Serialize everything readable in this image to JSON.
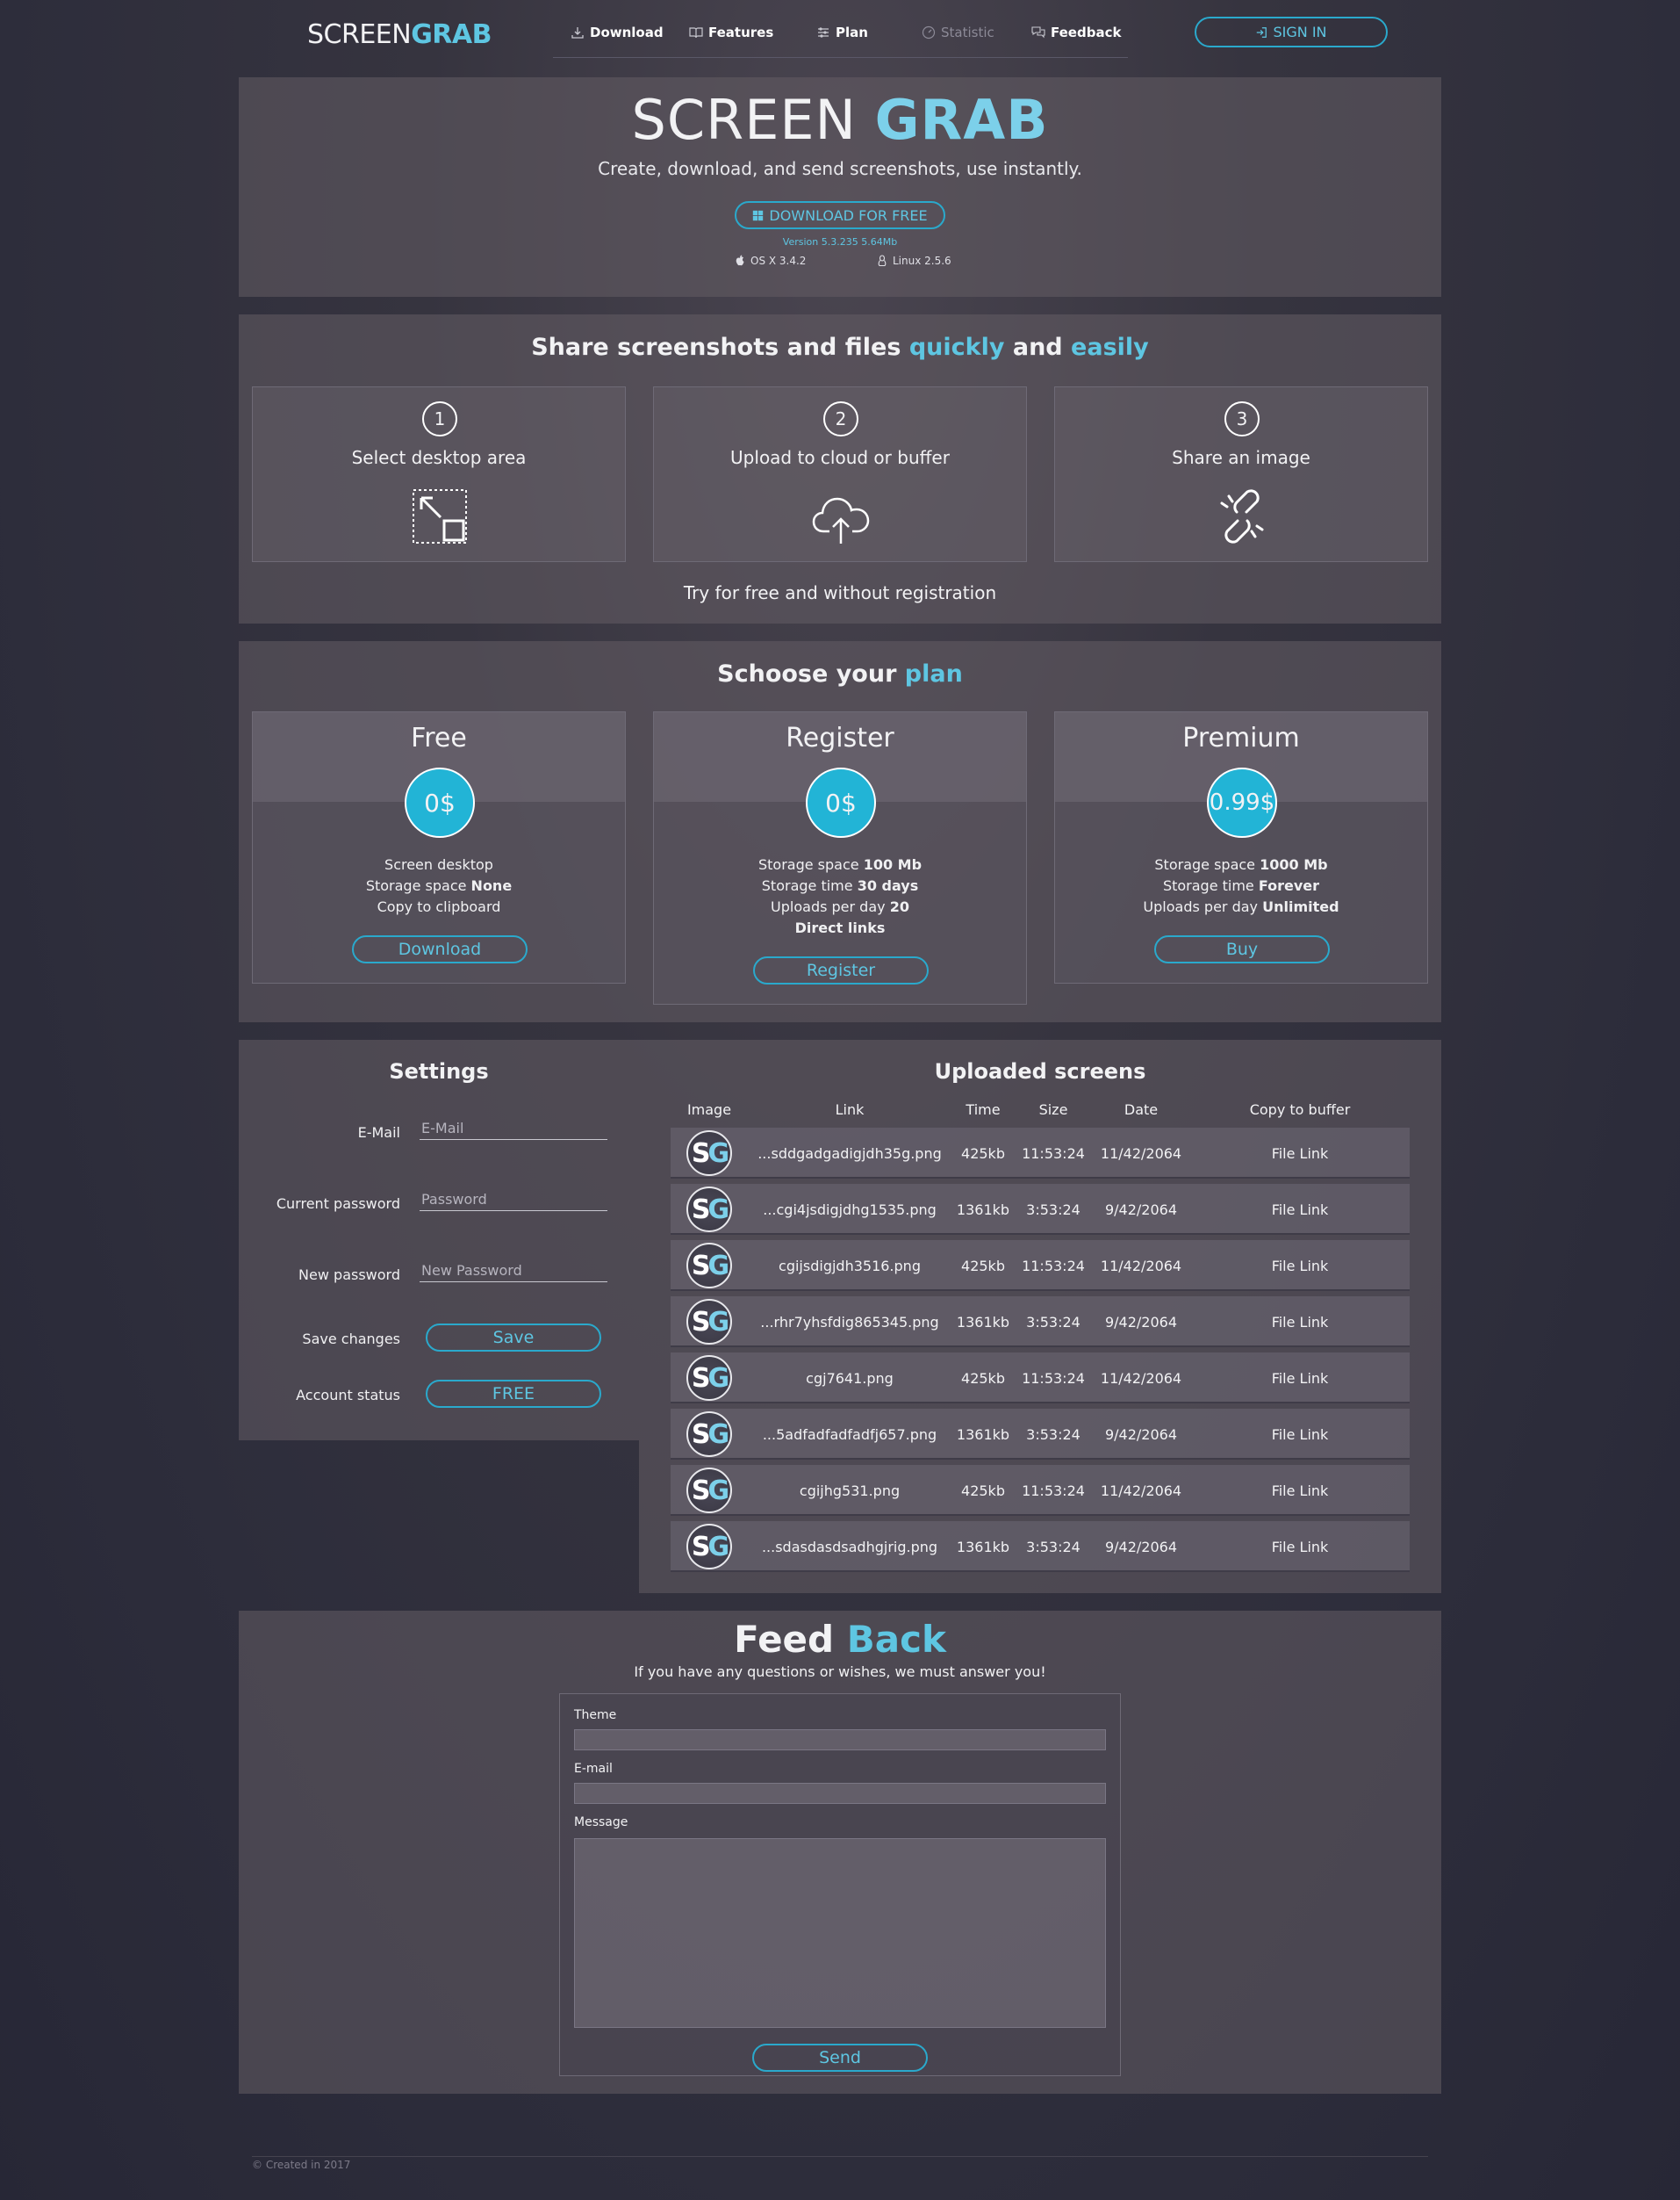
{
  "colors": {
    "accent": "#5ec6e2",
    "button_border": "#2aa9cc",
    "price_circle": "#22b4d6"
  },
  "header": {
    "logo_thin": "SCREEN",
    "logo_bold": "GRAB",
    "nav": [
      {
        "label": "Download",
        "icon": "download-icon"
      },
      {
        "label": "Features",
        "icon": "book-icon"
      },
      {
        "label": "Plan",
        "icon": "sliders-icon"
      },
      {
        "label": "Statistic",
        "icon": "gauge-icon"
      },
      {
        "label": "Feedback",
        "icon": "chat-icon"
      }
    ],
    "signin_label": "SIGN IN"
  },
  "hero": {
    "title_thin": "SCREEN",
    "title_bold": "GRAB",
    "subtitle": "Create, download, and send screenshots, use instantly.",
    "download_label": "DOWNLOAD FOR FREE",
    "version": "Version 5.3.235 5.64Mb",
    "os_mac": "OS X 3.4.2",
    "os_linux": "Linux 2.5.6"
  },
  "share": {
    "title_pre": "Share screenshots and files ",
    "title_quickly": "quickly",
    "title_and": " and ",
    "title_easily": "easily",
    "steps": [
      {
        "num": "1",
        "label": "Select desktop area",
        "icon": "select-area-icon"
      },
      {
        "num": "2",
        "label": "Upload to cloud or buffer",
        "icon": "cloud-upload-icon"
      },
      {
        "num": "3",
        "label": "Share an image",
        "icon": "link-icon"
      }
    ],
    "try_free": "Try for free and without registration"
  },
  "plans": {
    "title_pre": "Schoose your ",
    "title_accent": "plan",
    "items": [
      {
        "name": "Free",
        "price": "0$",
        "features": [
          {
            "text": "Screen desktop",
            "bold": ""
          },
          {
            "text": "Storage space ",
            "bold": "None"
          },
          {
            "text": "Copy to clipboard",
            "bold": ""
          }
        ],
        "button": "Download"
      },
      {
        "name": "Register",
        "price": "0$",
        "features": [
          {
            "text": "Storage space ",
            "bold": "100 Mb"
          },
          {
            "text": "Storage time ",
            "bold": "30 days"
          },
          {
            "text": "Uploads per day ",
            "bold": "20"
          },
          {
            "text": "",
            "bold": "Direct links"
          }
        ],
        "button": "Register"
      },
      {
        "name": "Premium",
        "price": "0.99$",
        "features": [
          {
            "text": "Storage space ",
            "bold": "1000 Mb"
          },
          {
            "text": "Storage time ",
            "bold": "Forever"
          },
          {
            "text": "Uploads per day ",
            "bold": "Unlimited"
          }
        ],
        "button": "Buy"
      }
    ]
  },
  "settings": {
    "title": "Settings",
    "email_label": "E-Mail",
    "email_placeholder": "E-Mail",
    "current_password_label": "Current password",
    "current_password_placeholder": "Password",
    "new_password_label": "New password",
    "new_password_placeholder": "New Password",
    "save_label": "Save changes",
    "save_button": "Save",
    "status_label": "Account status",
    "status_button": "FREE"
  },
  "uploads": {
    "title": "Uploaded screens",
    "columns": [
      "Image",
      "Link",
      "Time",
      "Size",
      "Date",
      "Copy to buffer"
    ],
    "thumb_s": "S",
    "thumb_g": "G",
    "rows": [
      {
        "link": "...sddgadgadigjdh35g.png",
        "size": "425kb",
        "time": "11:53:24",
        "date": "11/42/2064",
        "copy": "File Link"
      },
      {
        "link": "...cgi4jsdigjdhg1535.png",
        "size": "1361kb",
        "time": "3:53:24",
        "date": "9/42/2064",
        "copy": "File Link"
      },
      {
        "link": "cgijsdigjdh3516.png",
        "size": "425kb",
        "time": "11:53:24",
        "date": "11/42/2064",
        "copy": "File Link"
      },
      {
        "link": "...rhr7yhsfdig865345.png",
        "size": "1361kb",
        "time": "3:53:24",
        "date": "9/42/2064",
        "copy": "File Link"
      },
      {
        "link": "cgj7641.png",
        "size": "425kb",
        "time": "11:53:24",
        "date": "11/42/2064",
        "copy": "File Link"
      },
      {
        "link": "...5adfadfadfadfj657.png",
        "size": "1361kb",
        "time": "3:53:24",
        "date": "9/42/2064",
        "copy": "File Link"
      },
      {
        "link": "cgijhg531.png",
        "size": "425kb",
        "time": "11:53:24",
        "date": "11/42/2064",
        "copy": "File Link"
      },
      {
        "link": "...sdasdasdsadhgjrig.png",
        "size": "1361kb",
        "time": "3:53:24",
        "date": "9/42/2064",
        "copy": "File Link"
      }
    ]
  },
  "feedback": {
    "title_a": "Feed",
    "title_b": "Back",
    "subtitle": "If you have any questions or wishes, we must answer you!",
    "theme_label": "Theme",
    "email_label": "E-mail",
    "message_label": "Message",
    "send_button": "Send"
  },
  "footer": {
    "text": "© Created in 2017"
  }
}
